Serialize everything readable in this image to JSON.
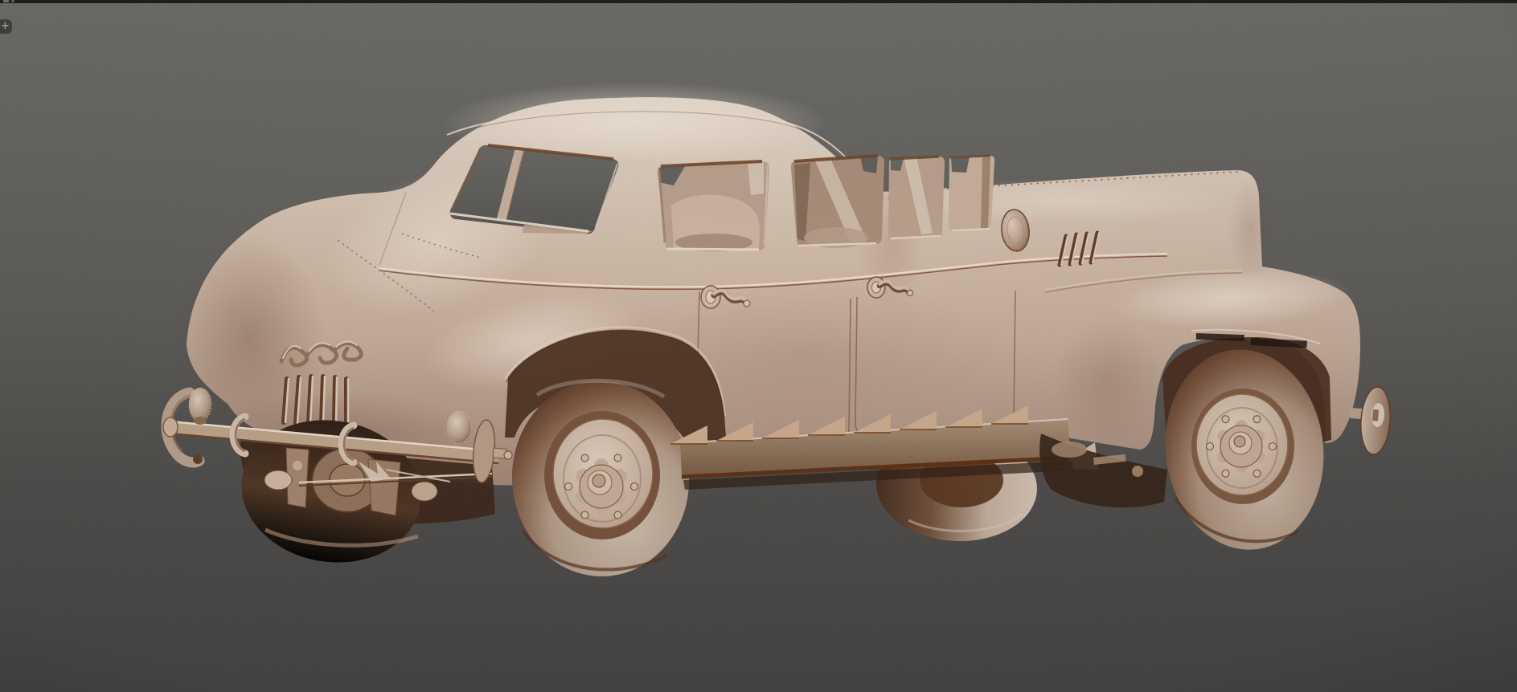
{
  "ui": {
    "top_bar": {
      "present": true
    },
    "add_tab": {
      "glyph": "+"
    }
  },
  "colors": {
    "bg-top": "#6b6a67",
    "bg-bottom": "#424140",
    "top-bar": "#1e1e1d",
    "tab-bg": "#3e3e3d",
    "tab-glyph": "#9a9893",
    "clay-light": "#dfd3c5",
    "clay-base": "#c3ac9b",
    "clay-mid": "#a98e7b",
    "clay-shadow": "#7e5f4b",
    "clay-dark": "#53341f",
    "underbody-dark": "#33201a",
    "window-gray": "#5c5b57"
  },
  "scene": {
    "object": "vintage automobile clay sculpt",
    "render_style": "monochrome clay 3d viewport"
  }
}
